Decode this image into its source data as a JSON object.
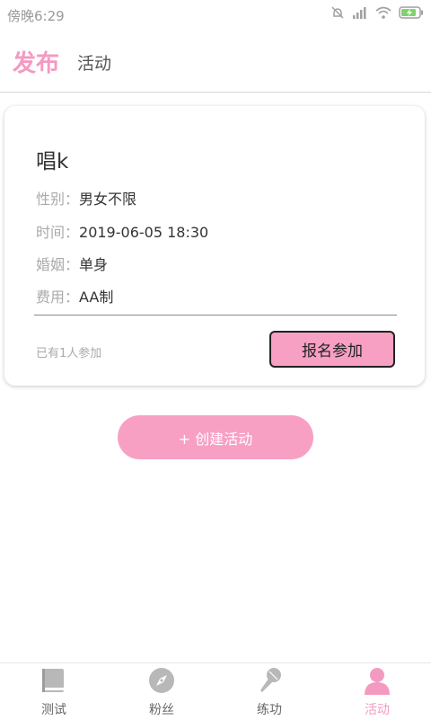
{
  "status_bar": {
    "time": "傍晚6:29"
  },
  "header": {
    "tab_publish": "发布",
    "tab_activity": "活动"
  },
  "card": {
    "title": "唱k",
    "rows": [
      {
        "label": "性别：",
        "value": "男女不限"
      },
      {
        "label": "时间：",
        "value": "2019-06-05 18:30"
      },
      {
        "label": "婚姻：",
        "value": "单身"
      },
      {
        "label": "费用：",
        "value": "AA制"
      }
    ],
    "participant_count": "已有1人参加",
    "join_button": "报名参加"
  },
  "create_button": "+ 创建活动",
  "bottom_nav": {
    "items": [
      {
        "label": "测试",
        "icon": "book-icon"
      },
      {
        "label": "粉丝",
        "icon": "compass-icon"
      },
      {
        "label": "练功",
        "icon": "microphone-icon"
      },
      {
        "label": "活动",
        "icon": "person-icon"
      }
    ]
  },
  "colors": {
    "accent": "#f49ac1",
    "button_fill": "#f7a0c4",
    "inactive_icon": "#b8b8b8"
  }
}
